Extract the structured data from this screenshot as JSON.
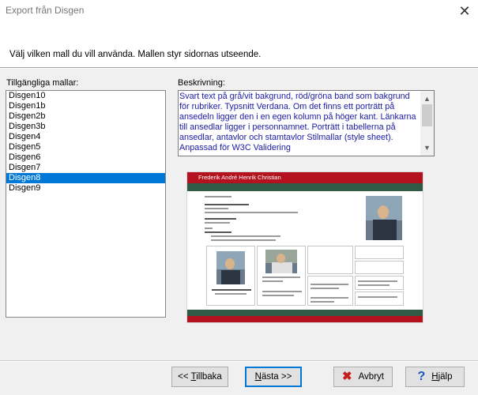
{
  "window": {
    "title": "Export från Disgen",
    "close_glyph": "✕"
  },
  "header": {
    "instruction": "Välj vilken mall du vill använda. Mallen styr sidornas utseende."
  },
  "templates": {
    "label": "Tillgängliga mallar:",
    "items": [
      "Disgen10",
      "Disgen1b",
      "Disgen2b",
      "Disgen3b",
      "Disgen4",
      "Disgen5",
      "Disgen6",
      "Disgen7",
      "Disgen8",
      "Disgen9"
    ],
    "selected": "Disgen8"
  },
  "description": {
    "label": "Beskrivning:",
    "text": "Svart text på grå/vit bakgrund, röd/gröna band som bakgrund för rubriker. Typsnitt Verdana. Om det finns ett porträtt på ansedeln ligger den i en egen kolumn på höger kant. Länkarna till ansedlar ligger i personnamnet. Porträtt i tabellerna på ansedlar, antavlor och stamtavlor Stilmallar (style sheet). Anpassad för W3C Validering",
    "text_color": "#1a1aa6",
    "scroll_up_icon": "chevron-up-icon",
    "scroll_down_icon": "chevron-down-icon"
  },
  "preview": {
    "header_title": "Frederik André Henrik Christian",
    "header_color": "#b3121e",
    "band_color": "#2f5b45"
  },
  "buttons": {
    "back": {
      "prefix": "<< ",
      "mnemonic": "T",
      "rest": "illbaka"
    },
    "next": {
      "mnemonic": "N",
      "rest": "ästa >>"
    },
    "cancel": {
      "label": "Avbryt",
      "icon": "x-icon"
    },
    "help": {
      "mnemonic": "H",
      "rest": "jälp",
      "icon": "question-icon"
    }
  }
}
